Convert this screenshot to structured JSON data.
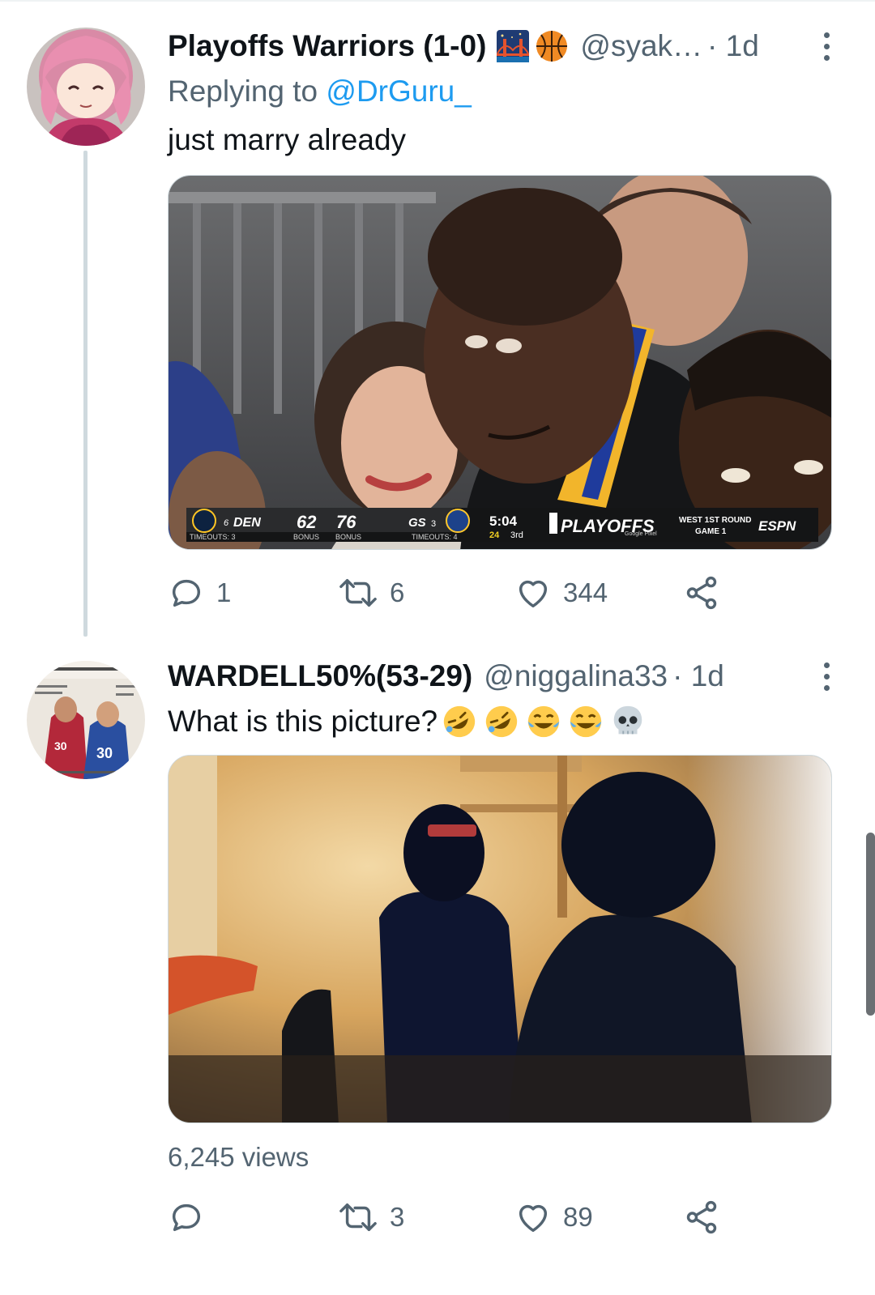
{
  "tweets": [
    {
      "display_name": "Playoffs Warriors (1-0)",
      "name_emojis": [
        "bridge-at-night-emoji",
        "basketball-emoji"
      ],
      "handle": "@syak…",
      "time": "· 1d",
      "replying_prefix": "Replying to",
      "replying_to": "@DrGuru_",
      "text": "just marry already",
      "media": {
        "scorebug": {
          "away_seed": "6",
          "away_team": "DEN",
          "away_score": "62",
          "home_score": "76",
          "home_team": "GS",
          "home_seed": "3",
          "away_timeouts": "TIMEOUTS: 3",
          "home_timeouts": "TIMEOUTS: 4",
          "bonus_left": "BONUS",
          "bonus_right": "BONUS",
          "clock": "5:04",
          "shot_clock": "24",
          "quarter": "3rd",
          "event": "PLAYOFFS",
          "sponsor": "Google Pixel",
          "round": "WEST 1ST ROUND",
          "game": "GAME 1",
          "network": "ESPN"
        }
      },
      "actions": {
        "replies": "1",
        "retweets": "6",
        "likes": "344"
      }
    },
    {
      "display_name": "WARDELL50%(53-29)",
      "handle": "@niggalina33",
      "time": "· 1d",
      "text": "What is this picture?",
      "text_emojis": [
        "rofl-emoji",
        "rofl-emoji",
        "joy-emoji",
        "joy-emoji",
        "skull-emoji"
      ],
      "views": "6,245 views",
      "actions": {
        "replies": "",
        "retweets": "3",
        "likes": "89"
      }
    }
  ],
  "colors": {
    "primary_text": "#0f1419",
    "secondary_text": "#536471",
    "link": "#1d9bf0",
    "thread_line": "#cfd9de"
  }
}
